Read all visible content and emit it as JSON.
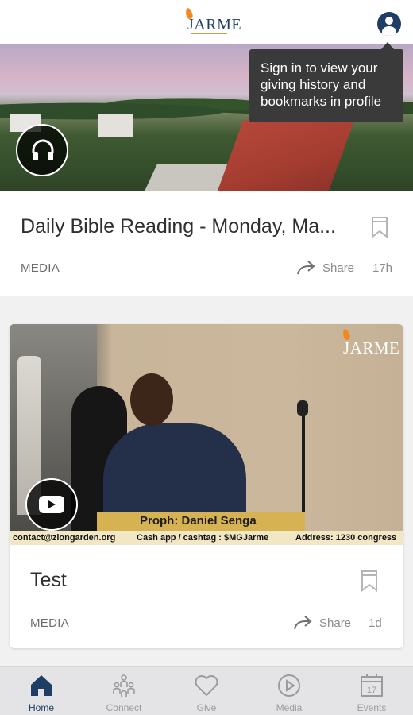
{
  "header": {
    "logo_text": "JARME",
    "profile_icon": "user-circle-icon"
  },
  "tooltip": {
    "text": "Sign in to view your giving history and bookmarks in profile"
  },
  "feed": [
    {
      "title": "Daily Bible Reading - Monday, Ma...",
      "category": "MEDIA",
      "share_label": "Share",
      "age": "17h",
      "media_icon": "headphones-icon"
    },
    {
      "title": "Test",
      "category": "MEDIA",
      "share_label": "Share",
      "age": "1d",
      "media_icon": "youtube-play-icon",
      "video_overlay": {
        "logo_text": "JARME",
        "speaker": "Proph: Daniel Senga",
        "ticker": [
          "contact@ziongarden.org",
          "Cash app / cashtag : $MGJarme",
          "Address: 1230 congress"
        ]
      }
    }
  ],
  "bottom_nav": {
    "items": [
      {
        "label": "Home",
        "icon": "home-icon",
        "active": true
      },
      {
        "label": "Connect",
        "icon": "people-icon",
        "active": false
      },
      {
        "label": "Give",
        "icon": "heart-icon",
        "active": false
      },
      {
        "label": "Media",
        "icon": "play-circle-icon",
        "active": false
      },
      {
        "label": "Events",
        "icon": "calendar-icon",
        "active": false
      }
    ],
    "calendar_day": "17"
  },
  "colors": {
    "brand_navy": "#1f3e66",
    "brand_orange": "#f08a1c",
    "tooltip_bg": "#3a3a3a",
    "nav_bg": "#e4e4e6"
  }
}
